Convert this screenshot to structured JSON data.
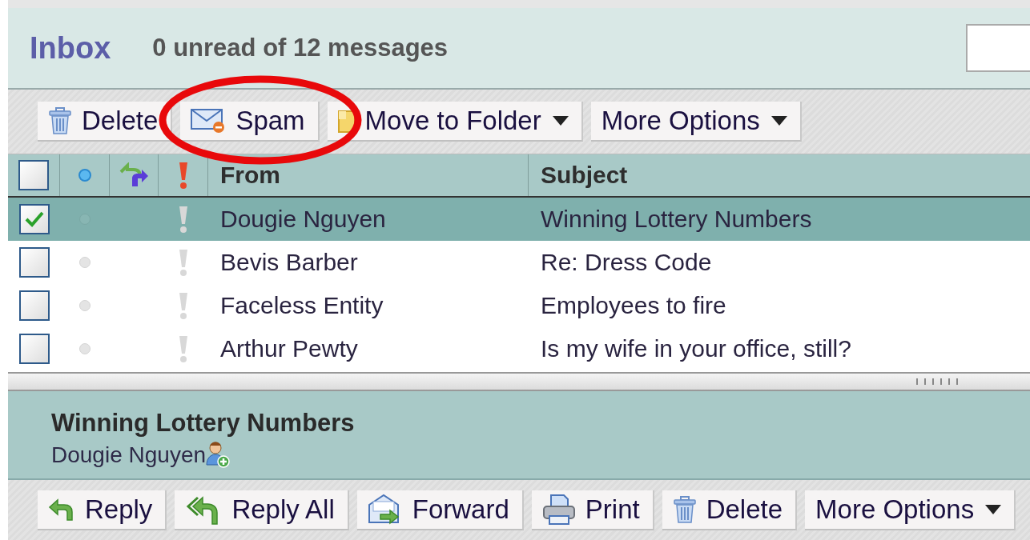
{
  "header": {
    "title": "Inbox",
    "summary": "0 unread of 12 messages"
  },
  "toolbar": [
    {
      "label": "Delete",
      "dropdown": false
    },
    {
      "label": "Spam",
      "dropdown": false
    },
    {
      "label": "Move to Folder",
      "dropdown": true
    },
    {
      "label": "More Options",
      "dropdown": true
    }
  ],
  "table": {
    "columns": [
      {
        "kind": "checkbox",
        "checked": false
      },
      {
        "kind": "unread"
      },
      {
        "kind": "replied"
      },
      {
        "kind": "priority"
      },
      {
        "kind": "text",
        "label": "From"
      },
      {
        "kind": "text",
        "label": "Subject"
      }
    ],
    "rows": [
      {
        "selected": true,
        "checked": true,
        "from": "Dougie Nguyen",
        "subject": "Winning Lottery Numbers"
      },
      {
        "selected": false,
        "checked": false,
        "from": "Bevis Barber",
        "subject": "Re: Dress Code"
      },
      {
        "selected": false,
        "checked": false,
        "from": "Faceless Entity",
        "subject": "Employees to fire"
      },
      {
        "selected": false,
        "checked": false,
        "from": "Arthur Pewty",
        "subject": "Is my wife in your office, still?"
      }
    ]
  },
  "preview": {
    "subject": "Winning Lottery Numbers",
    "sender": "Dougie Nguyen"
  },
  "actions": [
    {
      "label": "Reply",
      "dropdown": false
    },
    {
      "label": "Reply All",
      "dropdown": false
    },
    {
      "label": "Forward",
      "dropdown": false
    },
    {
      "label": "Print",
      "dropdown": false
    },
    {
      "label": "Delete",
      "dropdown": false
    },
    {
      "label": "More Options",
      "dropdown": true
    }
  ]
}
